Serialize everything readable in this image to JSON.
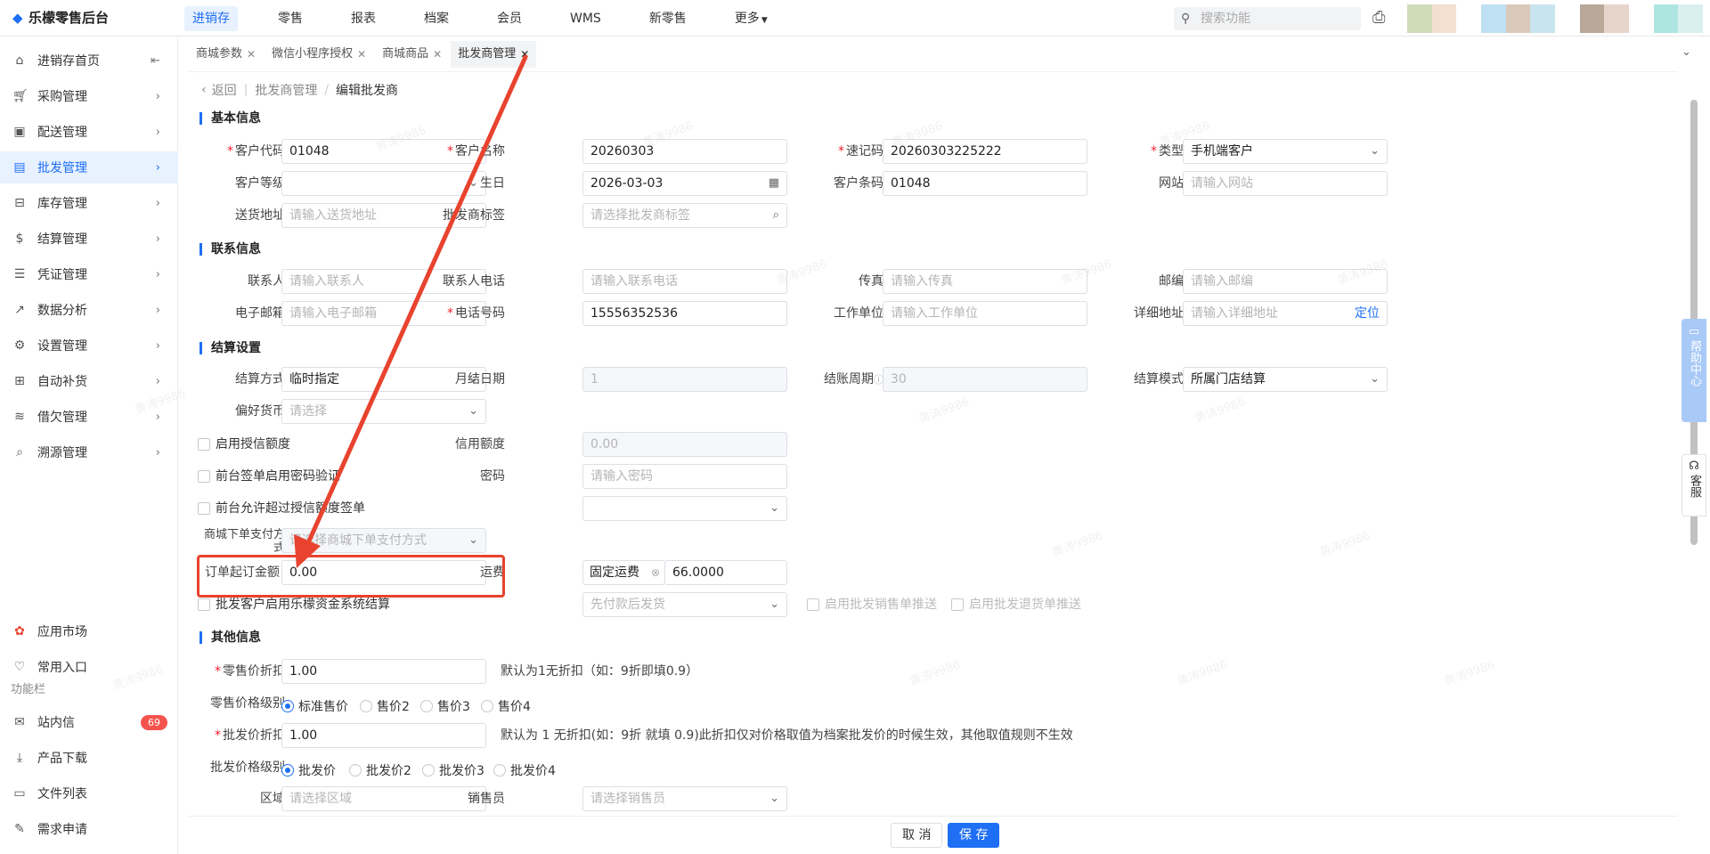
{
  "app": {
    "title": "乐檬零售后台"
  },
  "topnav": [
    "进销存",
    "零售",
    "报表",
    "档案",
    "会员",
    "WMS",
    "新零售",
    "更多"
  ],
  "search": {
    "placeholder": "搜索功能"
  },
  "sidebar": {
    "items": [
      "进销存首页",
      "采购管理",
      "配送管理",
      "批发管理",
      "库存管理",
      "结算管理",
      "凭证管理",
      "数据分析",
      "设置管理",
      "自动补货",
      "借欠管理",
      "溯源管理"
    ],
    "bottom": [
      "应用市场",
      "常用入口"
    ],
    "func_title": "功能栏",
    "func_items": [
      "站内信",
      "产品下载",
      "文件列表",
      "需求申请"
    ],
    "badge": "69"
  },
  "tabs": [
    "商城参数",
    "微信小程序授权",
    "商城商品",
    "批发商管理"
  ],
  "breadcrumb": {
    "back": "返回",
    "parent": "批发商管理",
    "current": "编辑批发商"
  },
  "sections": {
    "basic": "基本信息",
    "contact": "联系信息",
    "settle": "结算设置",
    "other": "其他信息"
  },
  "basic": {
    "code_label": "客户代码",
    "code": "01048",
    "name_label": "客户名称",
    "name": "20260303",
    "quick_label": "速记码",
    "quick": "20260303225222",
    "type_label": "类型",
    "type": "手机端客户",
    "level_label": "客户等级",
    "birthday_label": "生日",
    "birthday": "2026-03-03",
    "barcode_label": "客户条码",
    "barcode": "01048",
    "site_label": "网站",
    "site_ph": "请输入网站",
    "addr_label": "送货地址",
    "addr_ph": "请输入送货地址",
    "tag_label": "批发商标签",
    "tag_ph": "请选择批发商标签"
  },
  "contact": {
    "person_label": "联系人",
    "person_ph": "请输入联系人",
    "phone_label": "联系人电话",
    "phone_ph": "请输入联系电话",
    "fax_label": "传真",
    "fax_ph": "请输入传真",
    "zip_label": "邮编",
    "zip_ph": "请输入邮编",
    "email_label": "电子邮箱",
    "email_ph": "请输入电子邮箱",
    "mobile_label": "电话号码",
    "mobile": "15556352536",
    "company_label": "工作单位",
    "company_ph": "请输入工作单位",
    "detail_label": "详细地址",
    "detail_ph": "请输入详细地址",
    "locate": "定位"
  },
  "settle": {
    "method_label": "结算方式",
    "method": "临时指定",
    "monthday_label": "月结日期",
    "monthday": "1",
    "period_label": "结账周期",
    "period": "30",
    "mode_label": "结算模式",
    "mode": "所属门店结算",
    "currency_label": "偏好货币",
    "currency_ph": "请选择",
    "credit_enable": "启用授信额度",
    "credit_label": "信用额度",
    "credit": "0.00",
    "pwd_enable": "前台签单启用密码验证",
    "pwd_label": "密码",
    "pwd_ph": "请输入密码",
    "over_credit": "前台允许超过授信额度签单",
    "mall_pay_label": "商城下单支付方式",
    "mall_pay_ph": "请选择商城下单支付方式",
    "min_order_label": "订单起订金额",
    "min_order": "0.00",
    "freight_label": "运费",
    "freight_tag": "固定运费",
    "freight": "66.0000",
    "ship_mode": "先付款后发货",
    "lemeng_settle": "批发客户启用乐檬资金系统结算",
    "push_sale": "启用批发销售单推送",
    "push_return": "启用批发退货单推送"
  },
  "other": {
    "retail_disc_label": "零售价折扣",
    "retail_disc": "1.00",
    "retail_disc_hint": "默认为1无折扣（如：9折即填0.9）",
    "retail_level_label": "零售价格级别",
    "retail_levels": [
      "标准售价",
      "售价2",
      "售价3",
      "售价4"
    ],
    "whole_disc_label": "批发价折扣",
    "whole_disc": "1.00",
    "whole_disc_hint": "默认为 1 无折扣(如：9折 就填 0.9)此折扣仅对价格取值为档案批发价的时候生效，其他取值规则不生效",
    "whole_level_label": "批发价格级别",
    "whole_levels": [
      "批发价",
      "批发价2",
      "批发价3",
      "批发价4"
    ],
    "area_label": "区域",
    "area_ph": "请选择区域",
    "seller_label": "销售员",
    "seller_ph": "请选择销售员"
  },
  "footer": {
    "cancel": "取 消",
    "save": "保 存"
  },
  "help": "帮助中心",
  "service": "客服",
  "watermark": "黄涛9986"
}
